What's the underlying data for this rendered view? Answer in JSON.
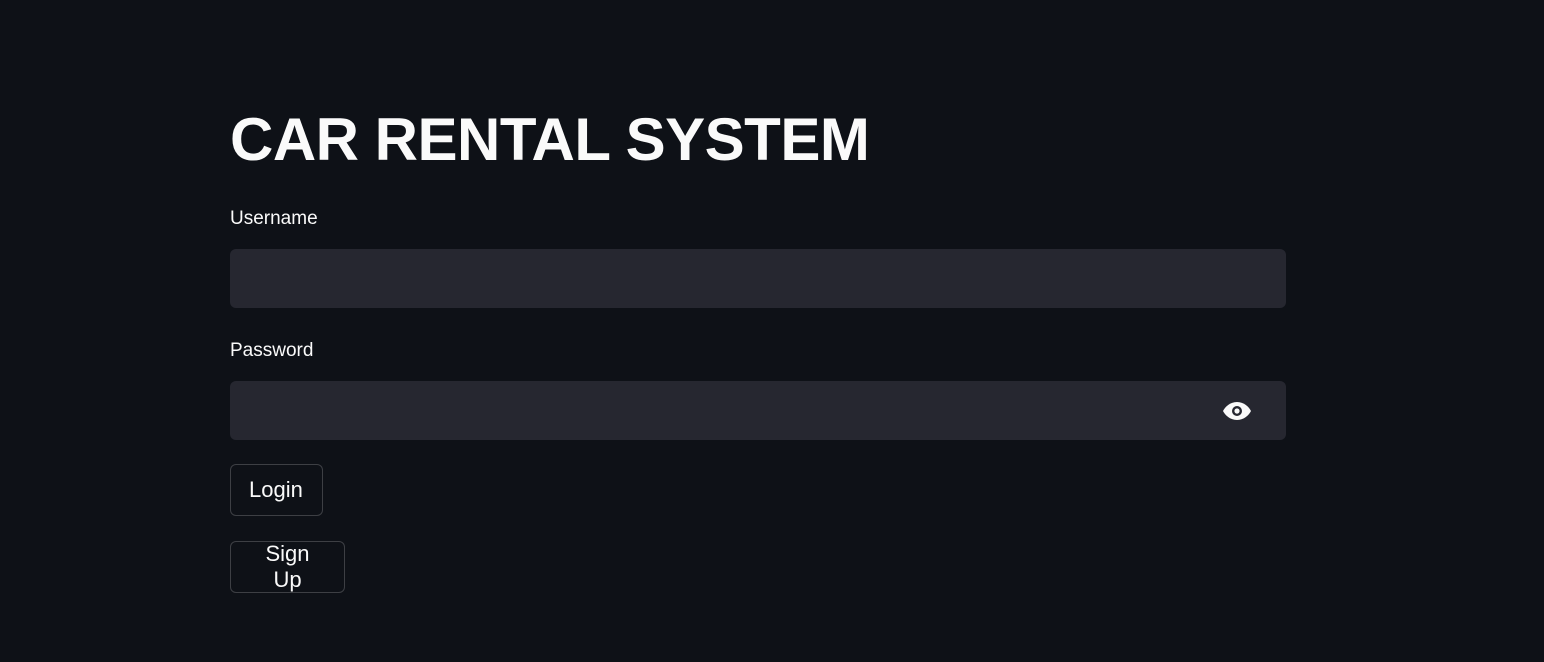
{
  "page": {
    "title": "CAR RENTAL SYSTEM"
  },
  "form": {
    "username": {
      "label": "Username",
      "value": "",
      "placeholder": ""
    },
    "password": {
      "label": "Password",
      "value": "",
      "placeholder": "",
      "toggle_icon": "eye-icon"
    },
    "login_label": "Login",
    "signup_label": "Sign Up"
  },
  "colors": {
    "background": "#0e1117",
    "input_background": "#262730",
    "text": "#fafafa"
  }
}
